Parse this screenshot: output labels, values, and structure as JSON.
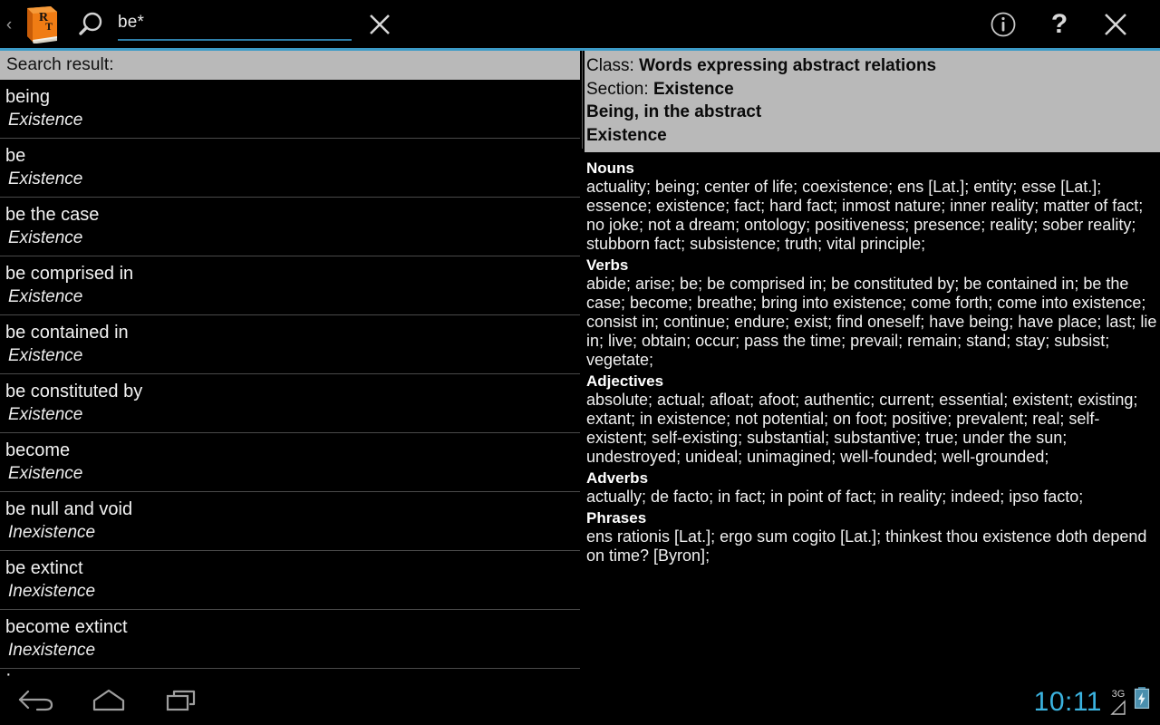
{
  "toolbar": {
    "back_label": "‹",
    "app_icon_letters": [
      "R",
      "T"
    ],
    "search_icon": "search-icon",
    "search_value": "be*",
    "search_placeholder": "",
    "clear_icon": "close-icon",
    "info_icon": "info-icon",
    "help_label": "?",
    "close_icon": "close-icon",
    "accent_color": "#3c9bc7"
  },
  "left_pane": {
    "header": "Search result:",
    "results": [
      {
        "word": "being",
        "category": "Existence"
      },
      {
        "word": "be",
        "category": "Existence"
      },
      {
        "word": "be the case",
        "category": "Existence"
      },
      {
        "word": "be comprised in",
        "category": "Existence"
      },
      {
        "word": "be contained in",
        "category": "Existence"
      },
      {
        "word": "be constituted by",
        "category": "Existence"
      },
      {
        "word": "become",
        "category": "Existence"
      },
      {
        "word": "be null and void",
        "category": "Inexistence"
      },
      {
        "word": "be extinct",
        "category": "Inexistence"
      },
      {
        "word": "become extinct",
        "category": "Inexistence"
      }
    ],
    "partial_row_word": "·"
  },
  "right_pane": {
    "class_label": "Class:",
    "class_value": "Words expressing abstract relations",
    "section_label": "Section:",
    "section_value": "Existence",
    "heading_1": "Being, in the abstract",
    "heading_2": "Existence",
    "entries": [
      {
        "pos": "Nouns",
        "terms": "actuality; being; center of life; coexistence; ens [Lat.]; entity; esse [Lat.]; essence; existence; fact; hard fact; inmost nature; inner reality; matter of fact; no joke; not a dream; ontology; positiveness; presence; reality; sober reality; stubborn fact; subsistence; truth; vital principle;"
      },
      {
        "pos": "Verbs",
        "terms": "abide; arise; be; be comprised in; be constituted by; be contained in; be the case; become; breathe; bring into existence; come forth; come into existence; consist in; continue; endure; exist; find oneself; have being; have place; last; lie in; live; obtain; occur; pass the time; prevail; remain; stand; stay; subsist; vegetate;"
      },
      {
        "pos": "Adjectives",
        "terms": "absolute; actual; afloat; afoot; authentic; current; essential; existent; existing; extant; in existence; not potential; on foot; positive; prevalent; real; self-existent; self-existing; substantial; substantive; true; under the sun; undestroyed; unideal; unimagined; well-founded; well-grounded;"
      },
      {
        "pos": "Adverbs",
        "terms": "actually; de facto; in fact; in point of fact; in reality; indeed; ipso facto;"
      },
      {
        "pos": "Phrases",
        "terms": "ens rationis [Lat.]; ergo sum cogito [Lat.]; thinkest thou existence doth depend on time? [Byron];"
      }
    ]
  },
  "navbar": {
    "back_icon": "back-arrow-icon",
    "home_icon": "home-icon",
    "recents_icon": "recent-apps-icon",
    "clock": "10:11",
    "network_label": "3G",
    "signal_icon": "signal-triangle-icon",
    "battery_icon": "battery-charging-icon",
    "clock_color": "#3bb3e0"
  }
}
